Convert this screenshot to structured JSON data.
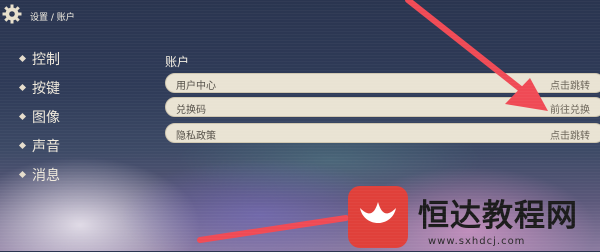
{
  "header": {
    "breadcrumb": "设置 / 账户",
    "icon": "gear-icon"
  },
  "sidebar": {
    "items": [
      {
        "label": "控制"
      },
      {
        "label": "按键"
      },
      {
        "label": "图像"
      },
      {
        "label": "声音"
      },
      {
        "label": "消息"
      }
    ]
  },
  "account": {
    "title": "账户",
    "rows": [
      {
        "label": "用户中心",
        "action": "点击跳转"
      },
      {
        "label": "兑换码",
        "action": "前往兑换"
      },
      {
        "label": "隐私政策",
        "action": "点击跳转"
      }
    ]
  },
  "watermark": {
    "brand": "恒达教程网",
    "url": "www.sxhdcj.com",
    "accent": "#e0403a"
  },
  "annotation": {
    "arrow_color": "#ef4a55"
  }
}
